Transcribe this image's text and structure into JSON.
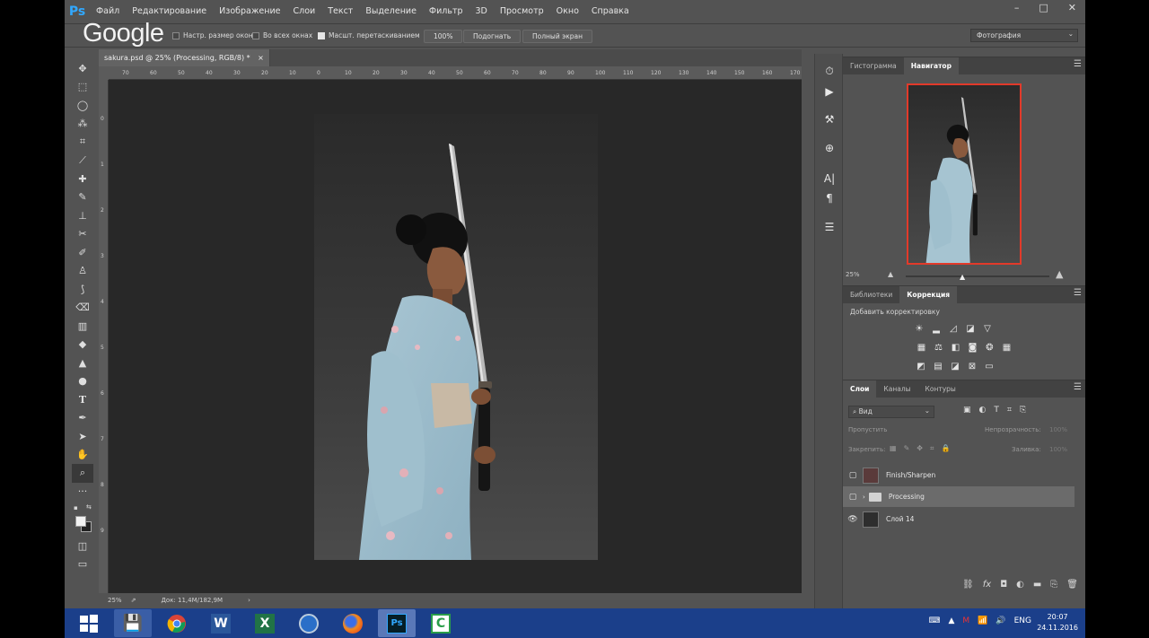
{
  "app": {
    "logo": "Ps",
    "overlay_watermark": "Google"
  },
  "menu": [
    "Файл",
    "Редактирование",
    "Изображение",
    "Слои",
    "Текст",
    "Выделение",
    "Фильтр",
    "3D",
    "Просмотр",
    "Окно",
    "Справка"
  ],
  "options": {
    "resize_windows": "Настр. размер окон",
    "all_windows": "Во всех окнах",
    "scrubby_zoom": "Масшт. перетаскиванием",
    "zoom_100": "100%",
    "fit_screen": "Подогнать",
    "fill_screen": "Полный экран",
    "workspace": "Фотография"
  },
  "document": {
    "tab_title": "sakura.psd @ 25% (Processing, RGB/8) *",
    "tab_close": "×",
    "zoom": "25%",
    "doc_info": "Док: 11,4M/182,9M"
  },
  "ruler": {
    "h_ticks": [
      "70",
      "60",
      "50",
      "40",
      "30",
      "20",
      "10",
      "0",
      "10",
      "20",
      "30",
      "40",
      "50",
      "60",
      "70",
      "80",
      "90",
      "100",
      "110",
      "120",
      "130",
      "140",
      "150",
      "160",
      "170"
    ],
    "v_ticks": [
      "0",
      "1",
      "2",
      "3",
      "4",
      "5",
      "6",
      "7",
      "8",
      "9"
    ]
  },
  "navigator": {
    "tabs": [
      "Гистограмма",
      "Навигатор"
    ],
    "active_tab": 1,
    "zoom": "25%",
    "zoom_slider_level": 0.4
  },
  "adjustments": {
    "tabs": [
      "Библиотеки",
      "Коррекция"
    ],
    "active_tab": 1,
    "heading": "Добавить корректировку",
    "row1": [
      "brightness-icon",
      "levels-icon",
      "curves-icon",
      "exposure-icon",
      "vibrance-icon"
    ],
    "row2": [
      "hue-saturation-icon",
      "color-balance-icon",
      "black-white-icon",
      "photo-filter-icon",
      "channel-mixer-icon",
      "color-lookup-icon"
    ],
    "row3": [
      "invert-icon",
      "posterize-icon",
      "threshold-icon",
      "selective-color-icon",
      "gradient-map-icon"
    ]
  },
  "layers": {
    "tabs": [
      "Слои",
      "Каналы",
      "Контуры"
    ],
    "active_tab": 0,
    "filter_label": "Вид",
    "blend_mode": "Пропустить",
    "opacity_label": "Непрозрачность:",
    "opacity_value": "100%",
    "lock_label": "Закрепить:",
    "fill_label": "Заливка:",
    "fill_value": "100%",
    "items": [
      {
        "name": "Finish/Sharpen",
        "visible": false,
        "type": "layer",
        "selected": false
      },
      {
        "name": "Processing",
        "visible": false,
        "type": "group",
        "selected": true
      },
      {
        "name": "Слой 14",
        "visible": true,
        "type": "layer",
        "selected": false
      }
    ]
  },
  "taskbar": {
    "apps": [
      "windows-start",
      "save-app",
      "chrome",
      "word",
      "excel",
      "thunderbird",
      "firefox",
      "photoshop",
      "camtasia"
    ],
    "active_app": "photoshop",
    "lang": "ENG",
    "time": "20:07",
    "date": "24.11.2016"
  },
  "colors": {
    "ps_accent": "#31a8ff",
    "nav_frame": "#e23a2a",
    "taskbar": "#1b3f8a"
  }
}
